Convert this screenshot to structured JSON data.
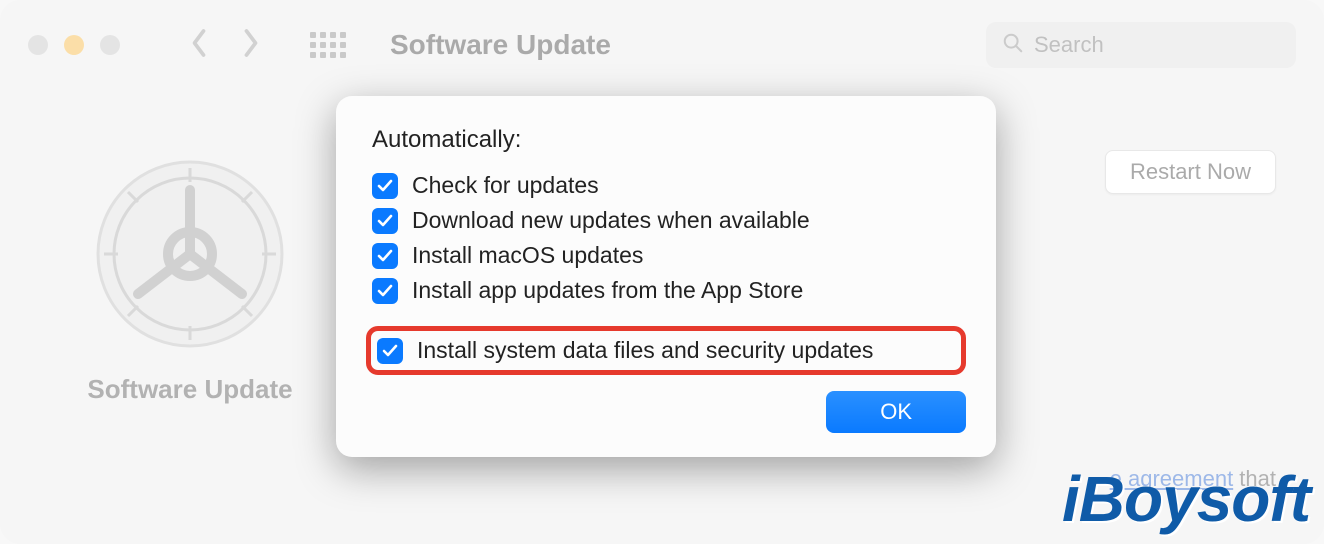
{
  "toolbar": {
    "title": "Software Update",
    "search_placeholder": "Search"
  },
  "sidebar": {
    "label": "Software Update"
  },
  "buttons": {
    "restart": "Restart Now",
    "ok": "OK"
  },
  "dialog": {
    "heading": "Automatically:",
    "options": [
      {
        "label": "Check for updates",
        "checked": true
      },
      {
        "label": "Download new updates when available",
        "checked": true
      },
      {
        "label": "Install macOS updates",
        "checked": true
      },
      {
        "label": "Install app updates from the App Store",
        "checked": true
      },
      {
        "label": "Install system data files and security updates",
        "checked": true,
        "highlighted": true
      }
    ]
  },
  "background_text": {
    "link_fragment": "e agreement",
    "tail": " that"
  },
  "watermark": "iBoysoft"
}
